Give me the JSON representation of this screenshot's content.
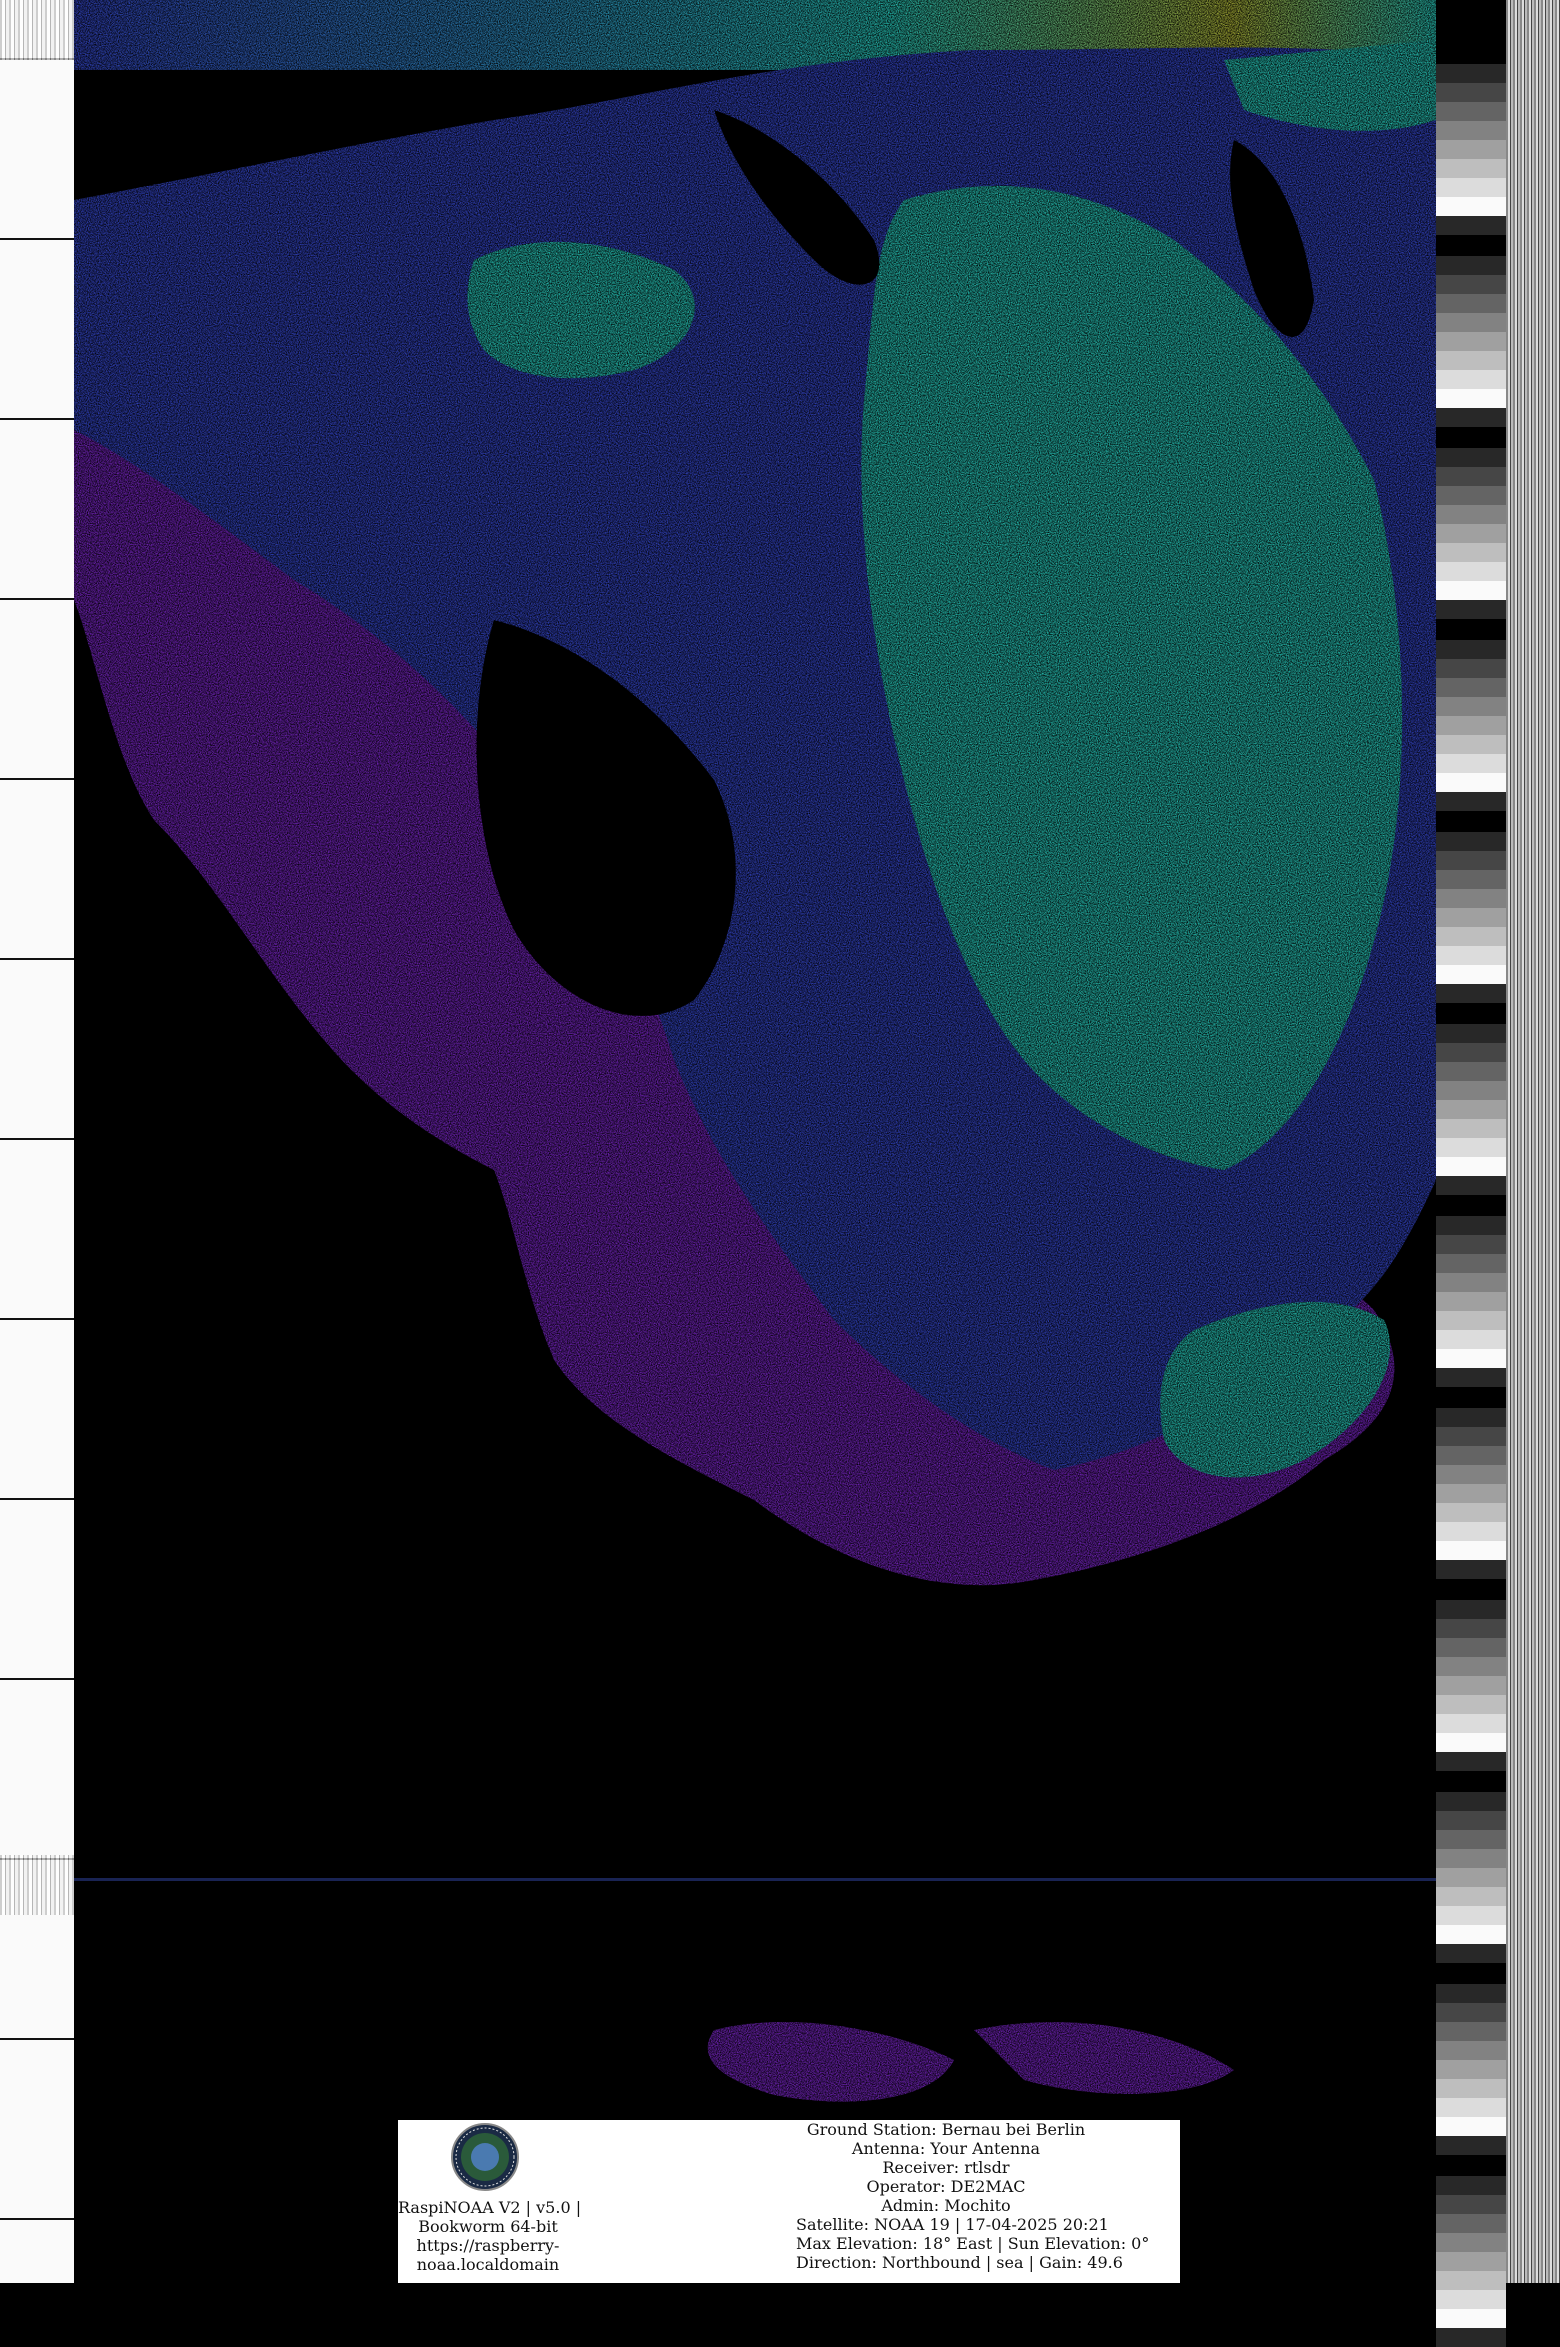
{
  "colors": {
    "clouds_low": "#8a2be2",
    "clouds_mid": "#3c50e6",
    "clouds_high": "#2ee8d8",
    "background": "#000000"
  },
  "logo": {
    "icon": "raspinoaa-logo-icon"
  },
  "left_panel": {
    "line1": "RaspiNOAA V2 | v5.0 |",
    "line2": "Bookworm 64-bit",
    "line3": "https://raspberry-",
    "line4": "noaa.localdomain"
  },
  "right_panel": {
    "ground_station": "Ground Station: Bernau bei Berlin",
    "antenna": "Antenna: Your Antenna",
    "receiver": "Receiver: rtlsdr",
    "operator": "Operator: DE2MAC",
    "admin": "Admin: Mochito",
    "satellite": "Satellite: NOAA 19 | 17-04-2025 20:21",
    "elevation": "Max Elevation: 18° East | Sun Elevation: 0°",
    "direction": "Direction: Northbound | sea | Gain: 49.6"
  }
}
